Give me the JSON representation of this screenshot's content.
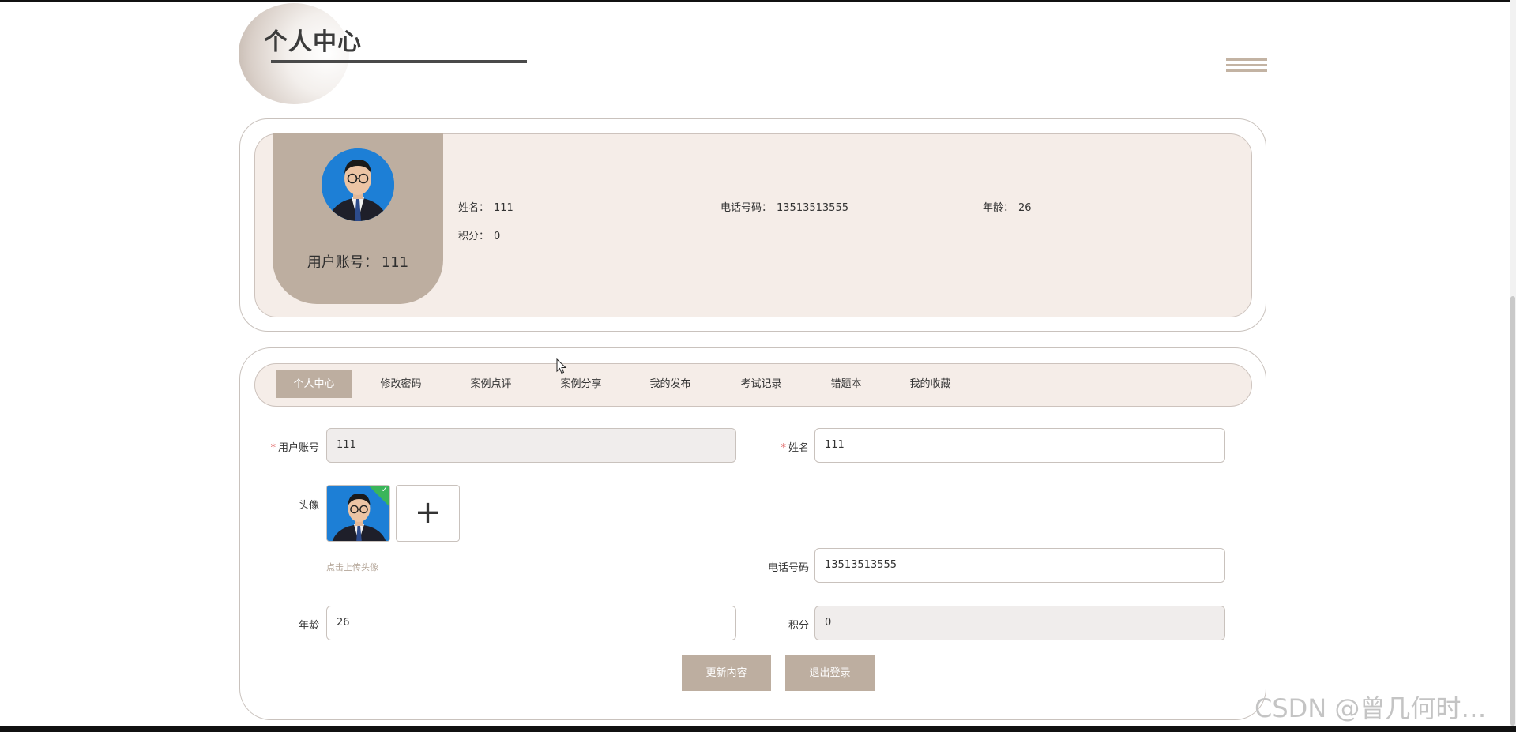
{
  "header": {
    "title": "个人中心"
  },
  "profile": {
    "account_label": "用户账号：",
    "account_value": "111",
    "info": [
      {
        "label": "姓名：",
        "value": "111"
      },
      {
        "label": "电话号码：",
        "value": "13513513555"
      },
      {
        "label": "年龄：",
        "value": "26"
      },
      {
        "label": "积分：",
        "value": "0"
      }
    ]
  },
  "tabs": [
    {
      "label": "个人中心",
      "active": true
    },
    {
      "label": "修改密码"
    },
    {
      "label": "案例点评"
    },
    {
      "label": "案例分享"
    },
    {
      "label": "我的发布"
    },
    {
      "label": "考试记录"
    },
    {
      "label": "错题本"
    },
    {
      "label": "我的收藏"
    }
  ],
  "form": {
    "required_mark": "*",
    "account": {
      "label": "用户账号",
      "value": "111",
      "disabled": true
    },
    "name": {
      "label": "姓名",
      "value": "111"
    },
    "avatar": {
      "label": "头像",
      "hint": "点击上传头像",
      "plus": "+",
      "check": "✓"
    },
    "phone": {
      "label": "电话号码",
      "value": "13513513555"
    },
    "age": {
      "label": "年龄",
      "value": "26"
    },
    "points": {
      "label": "积分",
      "value": "0",
      "disabled": true
    }
  },
  "buttons": {
    "update": "更新内容",
    "logout": "退出登录"
  },
  "watermark": "CSDN @曾几何时…",
  "colors": {
    "accent": "#bdaea0",
    "panel": "#f5ede8",
    "required": "#e06a6a",
    "upload_success": "#3ab55a"
  }
}
